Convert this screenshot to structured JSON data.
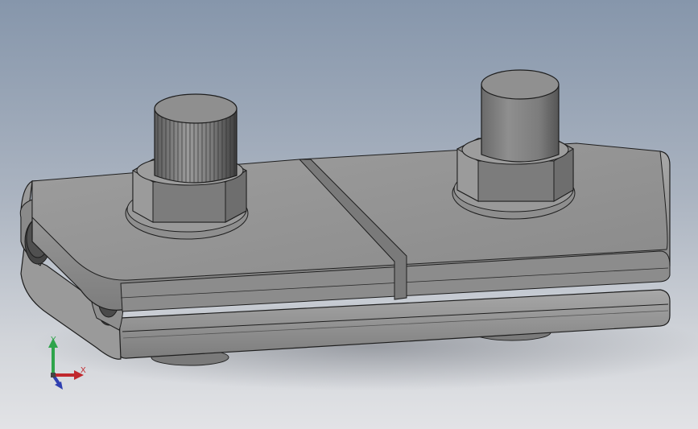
{
  "viewport": {
    "background_top": "#8696ab",
    "background_bottom": "#e2e3e6",
    "model_color": "#8f8f8f"
  },
  "triad": {
    "x_label": "X",
    "y_label": "Y",
    "x_color": "#c0282d",
    "y_color": "#2ea44a",
    "z_color": "#2f3fb0"
  },
  "model": {
    "parts": [
      "clamp-upper-plate",
      "clamp-lower-plate",
      "knurled-bolt",
      "smooth-bolt",
      "hex-nut-left",
      "hex-nut-right",
      "washer-left",
      "washer-right"
    ]
  }
}
